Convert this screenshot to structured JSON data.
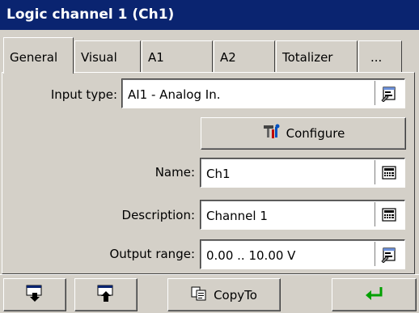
{
  "window": {
    "title": "Logic channel 1 (Ch1)"
  },
  "tabs": [
    {
      "label": "General"
    },
    {
      "label": "Visual"
    },
    {
      "label": "A1"
    },
    {
      "label": "A2"
    },
    {
      "label": "Totalizer"
    },
    {
      "label": "..."
    }
  ],
  "form": {
    "input_type": {
      "label": "Input type:",
      "value": "AI1 - Analog In."
    },
    "configure_label": "Configure",
    "name": {
      "label": "Name:",
      "value": "Ch1"
    },
    "description": {
      "label": "Description:",
      "value": "Channel 1"
    },
    "output_range": {
      "label": "Output range:",
      "value": "0.00 .. 10.00 V"
    }
  },
  "toolbar": {
    "copyto_label": "CopyTo"
  },
  "colors": {
    "title_bar": "#0a2470",
    "background": "#d4d0c8",
    "enter_arrow": "#00a000"
  }
}
